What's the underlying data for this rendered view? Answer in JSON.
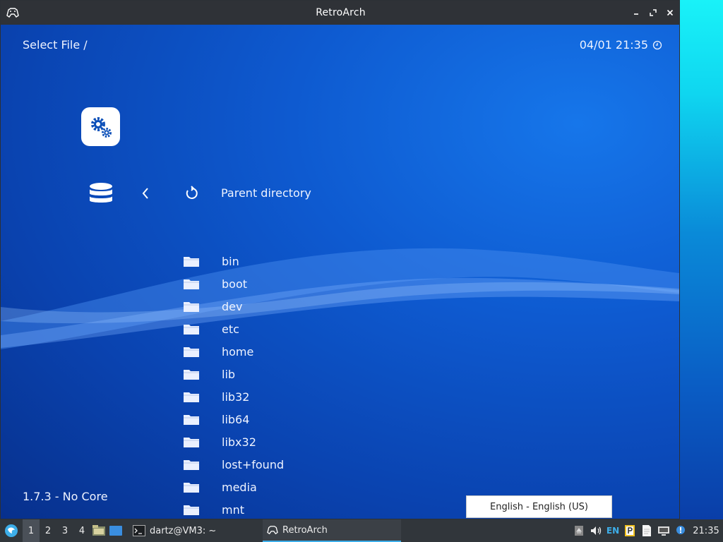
{
  "window": {
    "title": "RetroArch"
  },
  "header": {
    "breadcrumb": "Select File /",
    "datetime": "04/01 21:35"
  },
  "footer": {
    "version": "1.7.3 - No Core"
  },
  "navigation": {
    "parent_label": "Parent directory"
  },
  "files": [
    "bin",
    "boot",
    "dev",
    "etc",
    "home",
    "lib",
    "lib32",
    "lib64",
    "libx32",
    "lost+found",
    "media",
    "mnt"
  ],
  "popup": {
    "language": "English - English (US)"
  },
  "taskbar": {
    "workspaces": [
      "1",
      "2",
      "3",
      "4"
    ],
    "tasks": [
      {
        "label": "dartz@VM3: ~",
        "icon": "terminal-icon"
      },
      {
        "label": "RetroArch",
        "icon": "gamepad-icon"
      }
    ],
    "keyboard_layout": "EN",
    "clock": "21:35"
  },
  "colors": {
    "accent": "#3daee9",
    "bg_top": "#1676ea",
    "bg_bottom": "#07308c",
    "taskbar": "#31363b"
  }
}
